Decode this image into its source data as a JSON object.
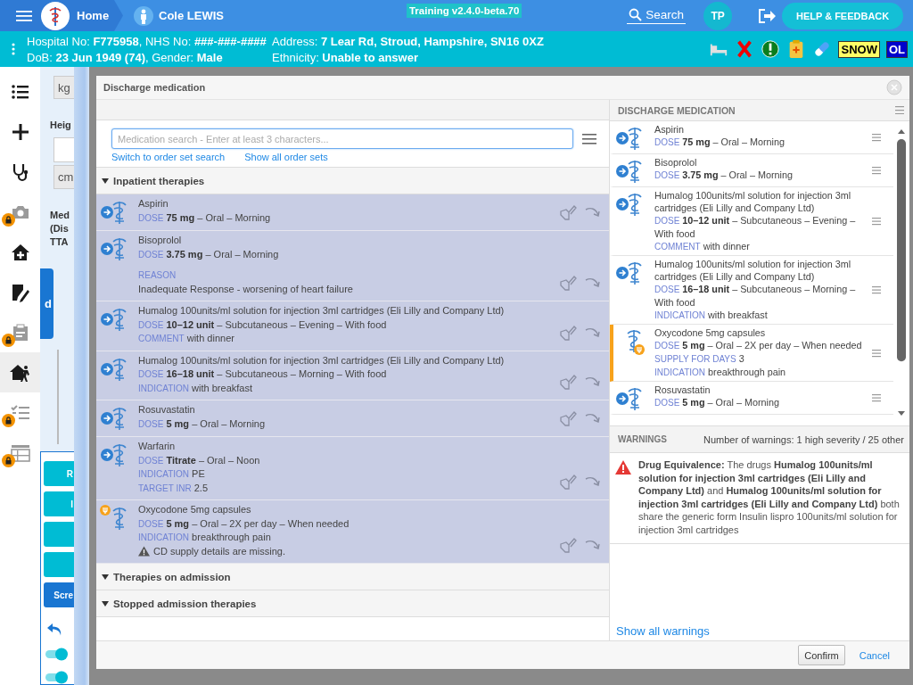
{
  "top_bar": {
    "home": "Home",
    "patient": "Cole LEWIS",
    "environment": "Training v2.4.0-beta.70",
    "search": "Search",
    "user_initials": "TP",
    "help_button": "HELP & FEEDBACK"
  },
  "patient_banner": {
    "lines": [
      "Hospital No: **F775958**, NHS No: **###-###-####**",
      "Address: **7 Lear Rd, Stroud, Hampshire, SN16 0XZ**",
      "DoB: **23 Jun 1949 (74)**, Gender: **Male**",
      "Ethnicity: **Unable to answer**"
    ],
    "flags": [
      {
        "kind": "bed"
      },
      {
        "kind": "cross"
      },
      {
        "kind": "alert"
      },
      {
        "kind": "clipboard"
      },
      {
        "kind": "pill"
      },
      {
        "kind": "tag",
        "label": "SNOW",
        "color": "#ffff66"
      },
      {
        "kind": "tag",
        "label": "OL",
        "color": "#0000cc"
      }
    ]
  },
  "sidebar": {
    "items": [
      {
        "kind": "list",
        "locked": false,
        "selected": false
      },
      {
        "kind": "plus",
        "locked": false,
        "selected": false
      },
      {
        "kind": "stethoscope",
        "locked": false,
        "selected": false
      },
      {
        "kind": "camera",
        "locked": true,
        "selected": false
      },
      {
        "kind": "home",
        "locked": false,
        "selected": false
      },
      {
        "kind": "signature",
        "locked": false,
        "selected": false
      },
      {
        "kind": "clipboard",
        "locked": true,
        "selected": false
      },
      {
        "kind": "house-person",
        "locked": false,
        "selected": true
      },
      {
        "kind": "checklist",
        "locked": true,
        "selected": false
      },
      {
        "kind": "table",
        "locked": true,
        "selected": false
      }
    ]
  },
  "background_form": {
    "weight_unit": "kg",
    "height_label": "Heig",
    "height_unit": "cm",
    "label_lines": [
      "Med",
      "(Dis",
      "TTA"
    ],
    "side_button": "d",
    "buttons": [
      {
        "kind": "teal",
        "label": "R"
      },
      {
        "kind": "teal",
        "label": "I"
      },
      {
        "kind": "teal"
      },
      {
        "kind": "teal"
      },
      {
        "kind": "primary",
        "label": "Scre"
      }
    ],
    "toggles": [
      {
        "on": true
      },
      {
        "on": true
      }
    ]
  },
  "dialog": {
    "title": "Discharge medication",
    "search": {
      "placeholder": "Medication search - Enter at least 3 characters...",
      "links": [
        "Switch to order set search",
        "Show all order sets"
      ]
    },
    "sections": [
      {
        "title": "Inpatient therapies",
        "items": [
          {
            "name": "Aspirin",
            "kind": "discharge",
            "selected": true,
            "details": [
              {
                "kind": "inline",
                "label": "DOSE",
                "value": "**75 mg** – Oral – Morning"
              }
            ]
          },
          {
            "name": "Bisoprolol",
            "kind": "discharge",
            "selected": true,
            "details": [
              {
                "kind": "inline",
                "label": "DOSE",
                "value": "**3.75 mg** – Oral – Morning"
              },
              {
                "kind": "block",
                "label": "REASON",
                "value": "Inadequate Response - worsening of heart failure"
              }
            ]
          },
          {
            "name": "Humalog 100units/ml solution for injection 3ml cartridges (Eli Lilly and Company Ltd)",
            "kind": "discharge",
            "selected": true,
            "details": [
              {
                "kind": "inline",
                "label": "DOSE",
                "value": "**10–12 unit** – Subcutaneous – Evening – With food"
              },
              {
                "kind": "inline",
                "label": "COMMENT",
                "value": "with dinner"
              }
            ]
          },
          {
            "name": "Humalog 100units/ml solution for injection 3ml cartridges (Eli Lilly and Company Ltd)",
            "kind": "discharge",
            "selected": true,
            "details": [
              {
                "kind": "inline",
                "label": "DOSE",
                "value": "**16–18 unit** – Subcutaneous – Morning – With food"
              },
              {
                "kind": "inline",
                "label": "INDICATION",
                "value": "with breakfast"
              }
            ]
          },
          {
            "name": "Rosuvastatin",
            "kind": "discharge",
            "selected": true,
            "details": [
              {
                "kind": "inline",
                "label": "DOSE",
                "value": "**5 mg** – Oral – Morning"
              }
            ]
          },
          {
            "name": "Warfarin",
            "kind": "discharge",
            "selected": true,
            "details": [
              {
                "kind": "inline",
                "label": "DOSE",
                "value": "**Titrate** – Oral – Noon"
              },
              {
                "kind": "inline",
                "label": "INDICATION",
                "value": "PE"
              },
              {
                "kind": "inline",
                "label": "TARGET INR",
                "value": "2.5"
              }
            ]
          },
          {
            "name": "Oxycodone 5mg capsules",
            "kind": "controlled",
            "selected": true,
            "details": [
              {
                "kind": "inline",
                "label": "DOSE",
                "value": "**5 mg** – Oral – 2X per day – When needed"
              },
              {
                "kind": "inline",
                "label": "INDICATION",
                "value": "breakthrough pain"
              },
              {
                "kind": "warning",
                "value": "CD supply details are missing."
              }
            ]
          }
        ]
      },
      {
        "title": "Therapies on admission"
      },
      {
        "title": "Stopped admission therapies"
      }
    ],
    "discharge_list": {
      "title": "DISCHARGE MEDICATION",
      "items": [
        {
          "name": "Aspirin",
          "kind": "discharge",
          "flagged": false,
          "details": [
            {
              "kind": "inline",
              "label": "DOSE",
              "value": "**75 mg** – Oral – Morning"
            }
          ]
        },
        {
          "name": "Bisoprolol",
          "kind": "discharge",
          "flagged": false,
          "details": [
            {
              "kind": "inline",
              "label": "DOSE",
              "value": "**3.75 mg** – Oral – Morning"
            }
          ]
        },
        {
          "name": "Humalog 100units/ml solution for injection 3ml cartridges (Eli Lilly and Company Ltd)",
          "kind": "discharge",
          "flagged": false,
          "details": [
            {
              "kind": "inline",
              "label": "DOSE",
              "value": "**10–12 unit** – Subcutaneous – Evening – With food"
            },
            {
              "kind": "inline",
              "label": "COMMENT",
              "value": "with dinner"
            }
          ]
        },
        {
          "name": "Humalog 100units/ml solution for injection 3ml cartridges (Eli Lilly and Company Ltd)",
          "kind": "discharge",
          "flagged": false,
          "details": [
            {
              "kind": "inline",
              "label": "DOSE",
              "value": "**16–18 unit** – Subcutaneous – Morning – With food"
            },
            {
              "kind": "inline",
              "label": "INDICATION",
              "value": "with breakfast"
            }
          ]
        },
        {
          "name": "Oxycodone 5mg capsules",
          "kind": "controlled",
          "flagged": true,
          "details": [
            {
              "kind": "inline",
              "label": "DOSE",
              "value": "**5 mg** – Oral – 2X per day – When needed"
            },
            {
              "kind": "inline",
              "label": "SUPPLY FOR DAYS",
              "value": "3"
            },
            {
              "kind": "inline",
              "label": "INDICATION",
              "value": "breakthrough pain"
            }
          ]
        },
        {
          "name": "Rosuvastatin",
          "kind": "discharge",
          "flagged": false,
          "details": [
            {
              "kind": "inline",
              "label": "DOSE",
              "value": "**5 mg** – Oral – Morning"
            }
          ]
        }
      ]
    },
    "warnings": {
      "title": "WARNINGS",
      "summary": "Number of warnings: 1 high severity / 25 other",
      "items": [
        {
          "text": "**Drug Equivalence:** The drugs **Humalog 100units/ml solution for injection 3ml cartridges (Eli Lilly and Company Ltd)** and **Humalog 100units/ml solution for injection 3ml cartridges (Eli Lilly and Company Ltd)** both share the generic form Insulin lispro 100units/ml solution for injection 3ml cartridges"
        }
      ],
      "show_all": "Show all warnings"
    },
    "buttons": [
      {
        "kind": "primary",
        "label": "Confirm"
      },
      {
        "kind": "link",
        "label": "Cancel"
      }
    ]
  }
}
